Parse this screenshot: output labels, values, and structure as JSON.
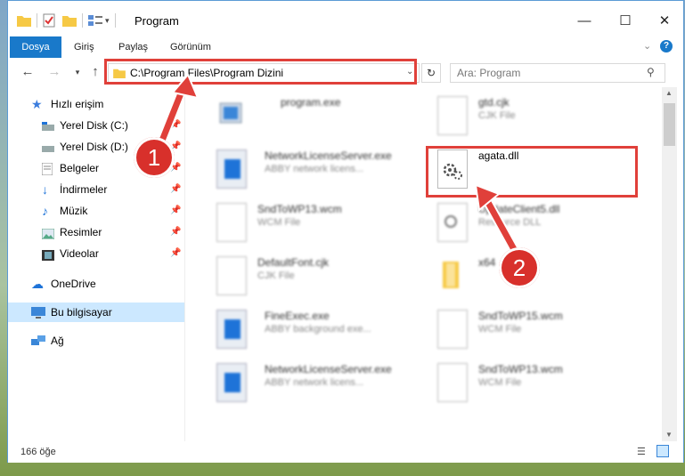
{
  "window": {
    "title": "Program",
    "controls": {
      "minimize": "—",
      "maximize": "☐",
      "close": "✕"
    }
  },
  "ribbon": {
    "tabs": [
      "Dosya",
      "Giriş",
      "Paylaş",
      "Görünüm"
    ]
  },
  "address": {
    "path": "C:\\Program Files\\Program Dizini",
    "search_placeholder": "Ara: Program"
  },
  "nav": {
    "items": [
      {
        "label": "Hızlı erişim",
        "icon": "star-icon",
        "pinned": false
      },
      {
        "label": "Yerel Disk (C:)",
        "icon": "drive-icon",
        "pinned": true
      },
      {
        "label": "Yerel Disk (D:)",
        "icon": "drive-icon",
        "pinned": true
      },
      {
        "label": "Belgeler",
        "icon": "documents-icon",
        "pinned": true
      },
      {
        "label": "İndirmeler",
        "icon": "download-icon",
        "pinned": true
      },
      {
        "label": "Müzik",
        "icon": "music-icon",
        "pinned": true
      },
      {
        "label": "Resimler",
        "icon": "pictures-icon",
        "pinned": true
      },
      {
        "label": "Videolar",
        "icon": "videos-icon",
        "pinned": true
      },
      {
        "label": "OneDrive",
        "icon": "cloud-icon",
        "pinned": false
      },
      {
        "label": "Bu bilgisayar",
        "icon": "computer-icon",
        "pinned": false
      },
      {
        "label": "Ağ",
        "icon": "network-icon",
        "pinned": false
      }
    ]
  },
  "files": [
    {
      "name": "program.exe",
      "type": ""
    },
    {
      "name": "gtd.cjk",
      "type": "CJK File"
    },
    {
      "name": "NetworkLicenseServer.exe",
      "type": "ABBY network licens..."
    },
    {
      "name": "agata.dll",
      "type": ""
    },
    {
      "name": "SndToWP13.wcm",
      "type": "WCM File"
    },
    {
      "name": "UpdateClient5.dll",
      "type": "Resource DLL"
    },
    {
      "name": "DefaultFont.cjk",
      "type": "CJK File"
    },
    {
      "name": "x64",
      "type": ""
    },
    {
      "name": "FineExec.exe",
      "type": "ABBY background exe..."
    },
    {
      "name": "SndToWP15.wcm",
      "type": "WCM File"
    },
    {
      "name": "NetworkLicenseServer.exe",
      "type": "ABBY network licens..."
    },
    {
      "name": "SndToWP13.wcm",
      "type": "WCM File"
    }
  ],
  "status": {
    "count": "166 öğe"
  },
  "annotations": {
    "step1": "1",
    "step2": "2"
  },
  "colors": {
    "accent": "#1979ca",
    "annotation": "#e0403a"
  }
}
